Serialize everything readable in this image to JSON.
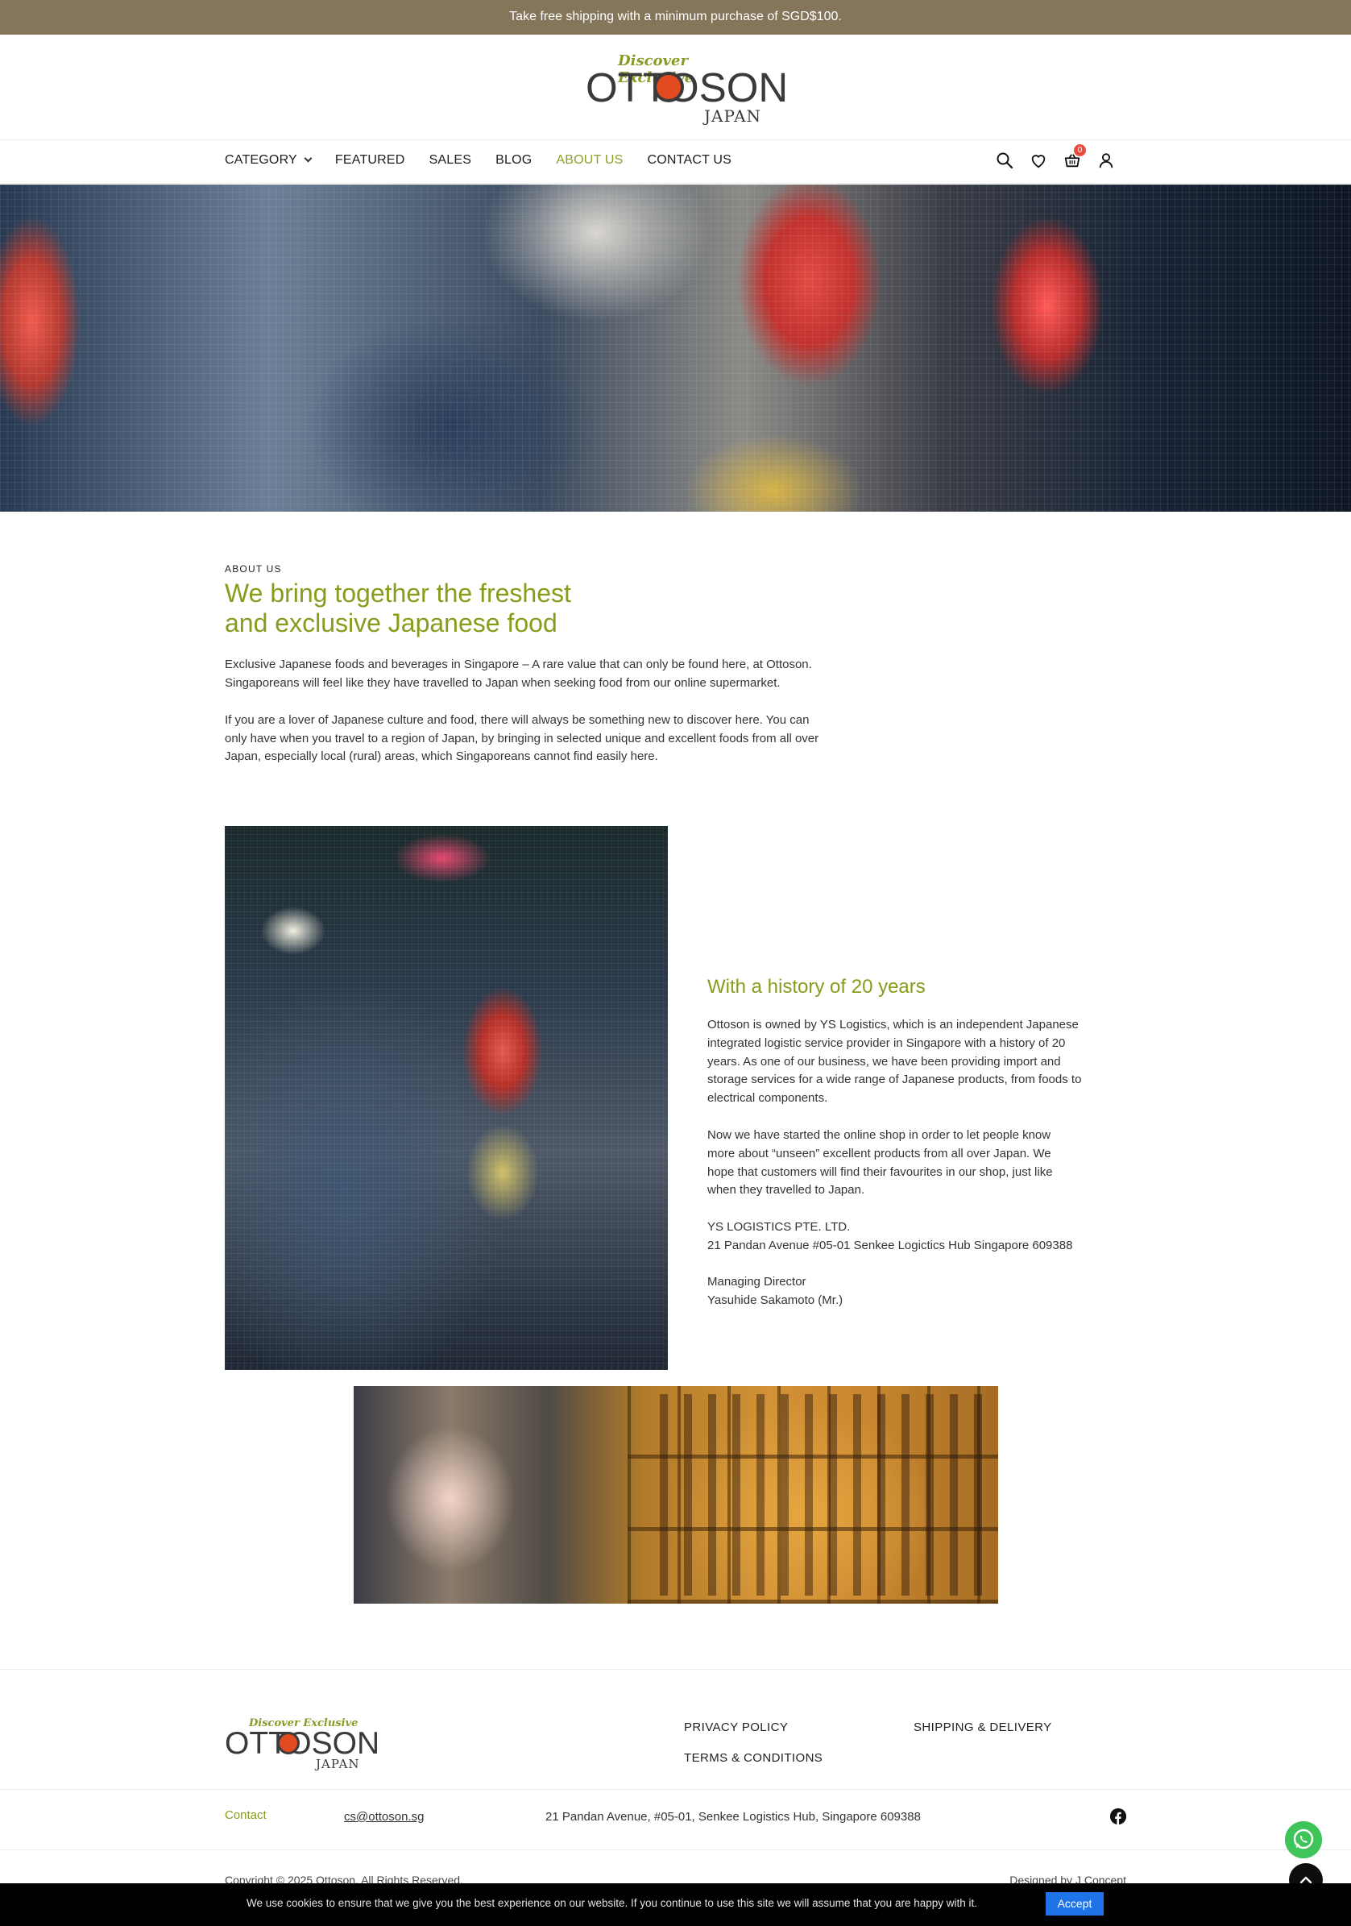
{
  "announcement": "Take free shipping with a minimum purchase of SGD$100.",
  "logo": {
    "tagline": "Discover Exclusive",
    "brand": "OTTOSON",
    "sub": "JAPAN"
  },
  "nav": {
    "items": [
      {
        "label": "CATEGORY",
        "has_dropdown": true
      },
      {
        "label": "FEATURED"
      },
      {
        "label": "SALES"
      },
      {
        "label": "BLOG"
      },
      {
        "label": "ABOUT US",
        "active": true
      },
      {
        "label": "CONTACT US"
      }
    ],
    "icons": [
      "search-icon",
      "heart-icon",
      "cart-icon",
      "user-icon"
    ],
    "cart_count": "0"
  },
  "about": {
    "eyebrow": "ABOUT US",
    "heading_line1": "We bring together the freshest",
    "heading_line2": "and exclusive Japanese food",
    "p1_line1": "Exclusive Japanese foods and beverages in Singapore – A rare value that can only be found here, at Ottoson.",
    "p1_line2": "Singaporeans will feel like they have travelled to Japan when seeking food from our online supermarket.",
    "p2_line1": "If you are a lover of Japanese culture and food, there will always be something new to discover here. You can",
    "p2_line2": "only have when you travel to a region of Japan, by bringing in selected unique and excellent foods from all over",
    "p2_line3": "Japan, especially local (rural) areas, which Singaporeans cannot find easily here."
  },
  "history": {
    "heading": "With a history of 20 years",
    "p1": [
      "Ottoson is owned by YS Logistics, which is an independent Japanese",
      "integrated logistic service provider in Singapore with a history of 20",
      "years. As one of our business, we have been providing import and",
      "storage services for a wide range of Japanese products, from foods to",
      "electrical components."
    ],
    "p2": [
      "Now we have started the online shop in order to let people know",
      "more about “unseen” excellent products from all over Japan. We",
      "hope that customers will find their favourites in our shop, just like",
      "when they travelled to Japan."
    ],
    "company": "YS LOGISTICS PTE. LTD.",
    "address": "21 Pandan Avenue #05-01 Senkee Logictics Hub Singapore 609388",
    "role": "Managing Director",
    "person": "Yasuhide Sakamoto (Mr.)"
  },
  "footer": {
    "links": {
      "privacy": "PRIVACY POLICY",
      "terms": "TERMS & CONDITIONS",
      "shipping": "SHIPPING & DELIVERY"
    },
    "contact_label": "Contact",
    "email": "cs@ottoson.sg",
    "address": "21 Pandan Avenue, #05-01, Senkee Logistics Hub, Singapore 609388",
    "copyright": "Copyright © 2025 Ottoson. All Rights Reserved.",
    "designed_by": "Designed by J Concept"
  },
  "cookie": {
    "text": "We use cookies to ensure that we give you the best experience on our website. If you continue to use this site we will assume that you are happy with it.",
    "accept_label": "Accept"
  },
  "colors": {
    "accent": "#8a9b1c",
    "topbar": "#84765a",
    "cart_badge": "#e94b3c",
    "whatsapp": "#3fc45a",
    "accept_button": "#1e73e8"
  }
}
